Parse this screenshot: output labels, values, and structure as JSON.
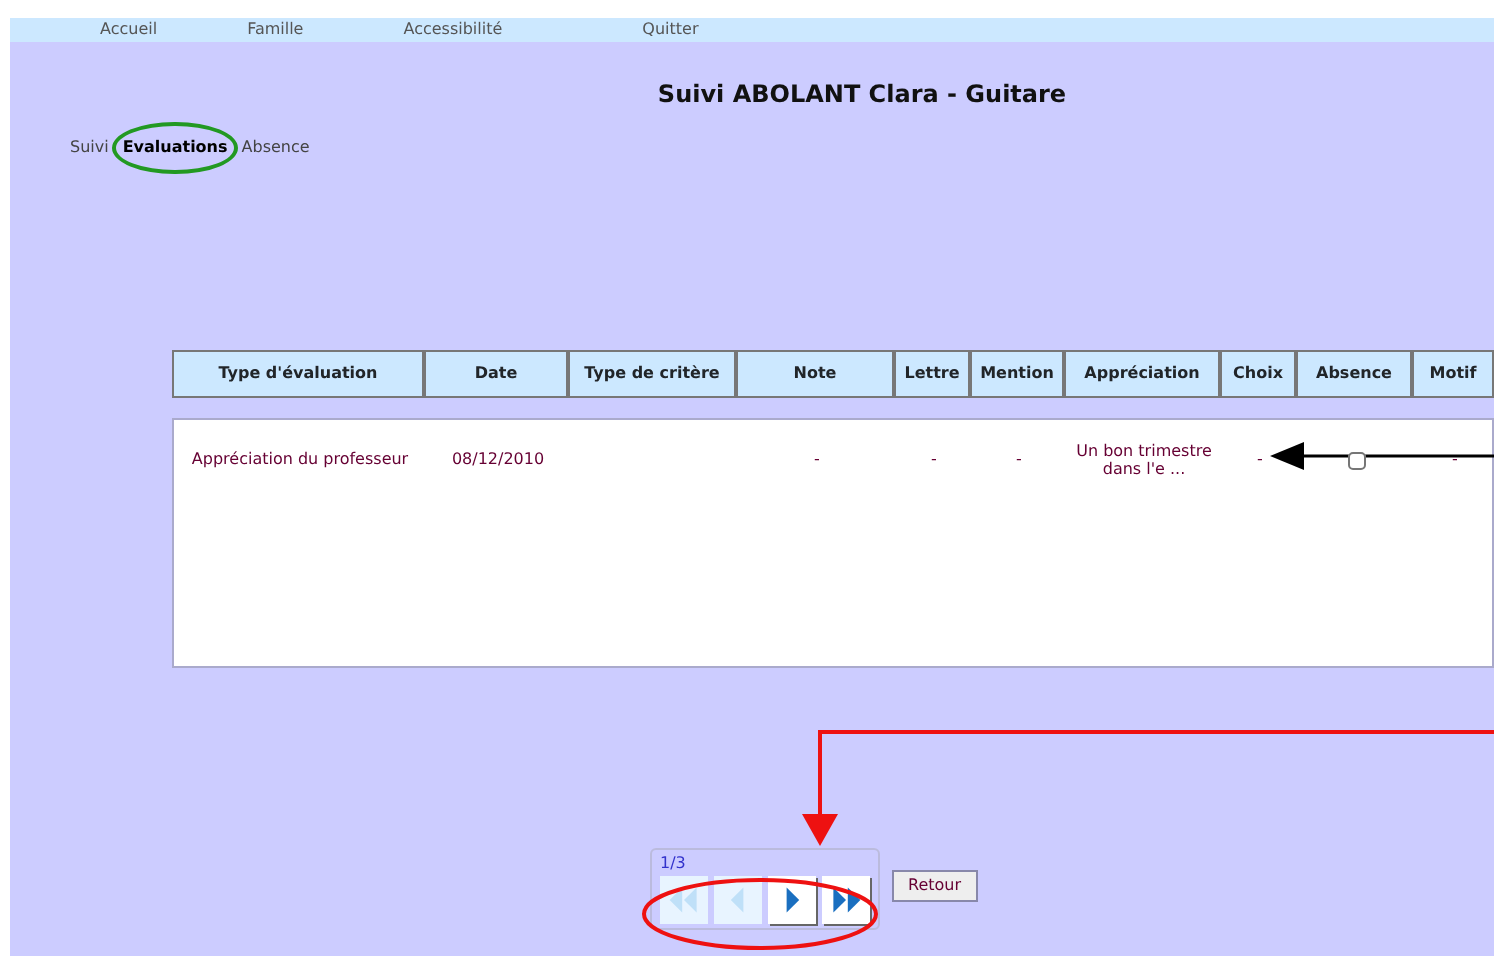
{
  "menu": [
    "Accueil",
    "Famille",
    "Accessibilité",
    "Quitter"
  ],
  "title": "Suivi ABOLANT Clara - Guitare",
  "tabs": [
    {
      "label": "Suivi",
      "selected": false
    },
    {
      "label": "Evaluations",
      "selected": true
    },
    {
      "label": "Absence",
      "selected": false
    }
  ],
  "table": {
    "columns": [
      "Type d'évaluation",
      "Date",
      "Type de critère",
      "Note",
      "Lettre",
      "Mention",
      "Appréciation",
      "Choix",
      "Absence",
      "Motif"
    ],
    "rows": [
      {
        "type": "Appréciation du professeur",
        "date": "08/12/2010",
        "critere": "",
        "note": "-",
        "lettre": "-",
        "mention": "-",
        "appreciation": "Un bon trimestre dans l'e ...",
        "choix": "-",
        "absence_checked": false,
        "motif": "-"
      }
    ]
  },
  "pager": {
    "page": "1/3",
    "buttons": [
      {
        "kind": "first",
        "disabled": true
      },
      {
        "kind": "prev",
        "disabled": true
      },
      {
        "kind": "next",
        "disabled": false
      },
      {
        "kind": "last",
        "disabled": false
      }
    ]
  },
  "back_button": "Retour"
}
